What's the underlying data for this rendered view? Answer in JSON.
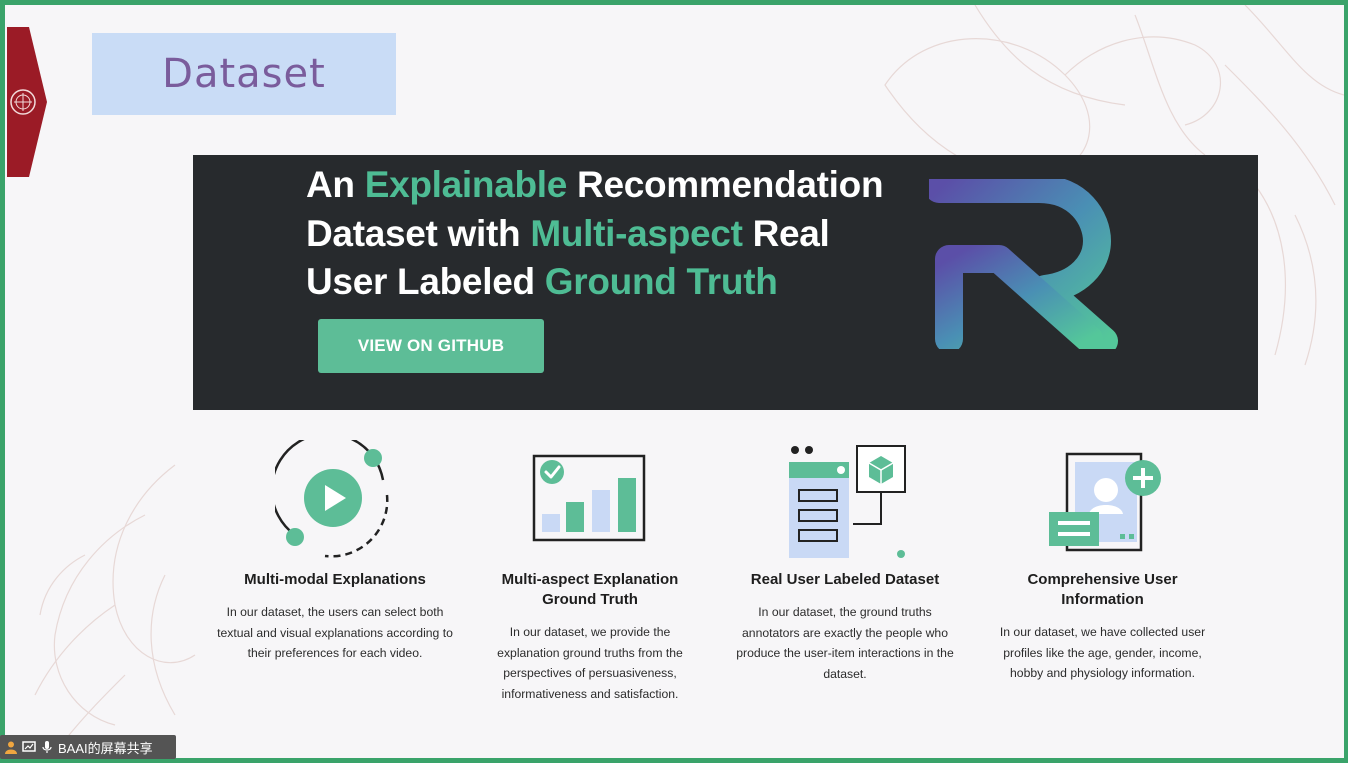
{
  "slide": {
    "title": "Dataset"
  },
  "hero": {
    "headline": [
      {
        "text": "An ",
        "highlight": false
      },
      {
        "text": "Explainable",
        "highlight": true
      },
      {
        "text": " Recommendation",
        "highlight": false
      },
      {
        "text": "Dataset with ",
        "highlight": false
      },
      {
        "text": "Multi-aspect",
        "highlight": true
      },
      {
        "text": " Real",
        "highlight": false
      },
      {
        "text": "User Labeled ",
        "highlight": false
      },
      {
        "text": "Ground Truth",
        "highlight": true
      }
    ],
    "button_label": "VIEW ON GITHUB",
    "accent_color": "#4ebc94",
    "background_color": "#272a2d"
  },
  "features": [
    {
      "icon": "play-circle-icon",
      "title": "Multi-modal Explanations",
      "description": "In our dataset, the users can select both textual and visual explanations according to their preferences for each video."
    },
    {
      "icon": "bar-chart-check-icon",
      "title": "Multi-aspect Explanation Ground Truth",
      "description": "In our dataset, we provide the explanation ground truths from the perspectives of persuasiveness, informativeness and satisfaction."
    },
    {
      "icon": "database-cube-icon",
      "title": "Real User Labeled Dataset",
      "description": "In our dataset, the ground truths annotators are exactly the people who produce the user-item interactions in the dataset."
    },
    {
      "icon": "user-profile-add-icon",
      "title": "Comprehensive User Information",
      "description": "In our dataset, we have collected user profiles like the age, gender, income, hobby and physiology information."
    }
  ],
  "taskbar": {
    "label": "BAAI的屏幕共享"
  }
}
